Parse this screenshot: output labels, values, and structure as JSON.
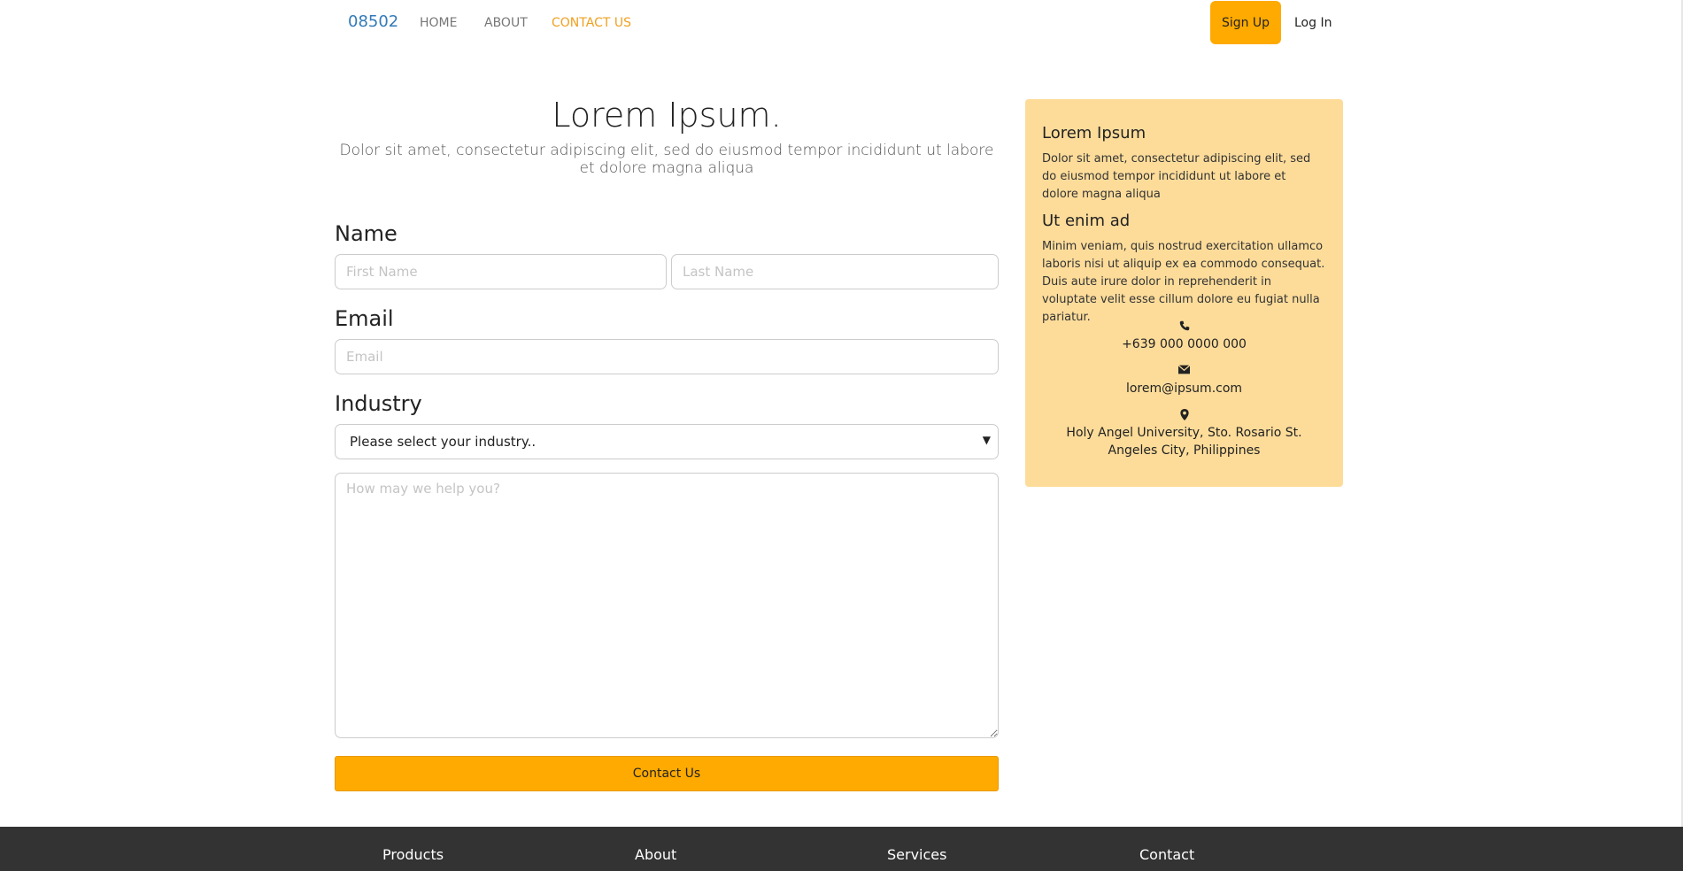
{
  "nav": {
    "brand": "08502",
    "links": [
      "HOME",
      "ABOUT",
      "CONTACT US"
    ],
    "signup": "Sign Up",
    "login": "Log In"
  },
  "hero": {
    "title": "Lorem Ipsum.",
    "subtitle": "Dolor sit amet, consectetur adipiscing elit, sed do eiusmod tempor incididunt ut labore et dolore magna aliqua"
  },
  "form": {
    "name_label": "Name",
    "first_name_placeholder": "First Name",
    "last_name_placeholder": "Last Name",
    "email_label": "Email",
    "email_placeholder": "Email",
    "industry_label": "Industry",
    "industry_selected": "Please select your industry..",
    "message_placeholder": "How may we help you?",
    "submit": "Contact Us"
  },
  "info": {
    "heading1": "Lorem Ipsum",
    "text1": "Dolor sit amet, consectetur adipiscing elit, sed do eiusmod tempor incididunt ut labore et dolore magna aliqua",
    "heading2": "Ut enim ad",
    "text2": "Minim veniam, quis nostrud exercitation ullamco laboris nisi ut aliquip ex ea commodo consequat. Duis aute irure dolor in reprehenderit in voluptate velit esse cillum dolore eu fugiat nulla pariatur.",
    "phone_icon": "phone-icon",
    "phone": "+639 000 0000 000",
    "email_icon": "envelope-icon",
    "email": "lorem@ipsum.com",
    "location_icon": "map-marker-icon",
    "address": "Holy Angel University, Sto. Rosario St. Angeles City, Philippines"
  },
  "footer": {
    "items": [
      "Products",
      "About",
      "Services",
      "Contact"
    ]
  },
  "colors": {
    "accent": "#ffaa00",
    "card_bg": "#fddc9a",
    "brand": "#337ab7",
    "active_link": "#f0a020",
    "footer_bg": "#333333"
  }
}
